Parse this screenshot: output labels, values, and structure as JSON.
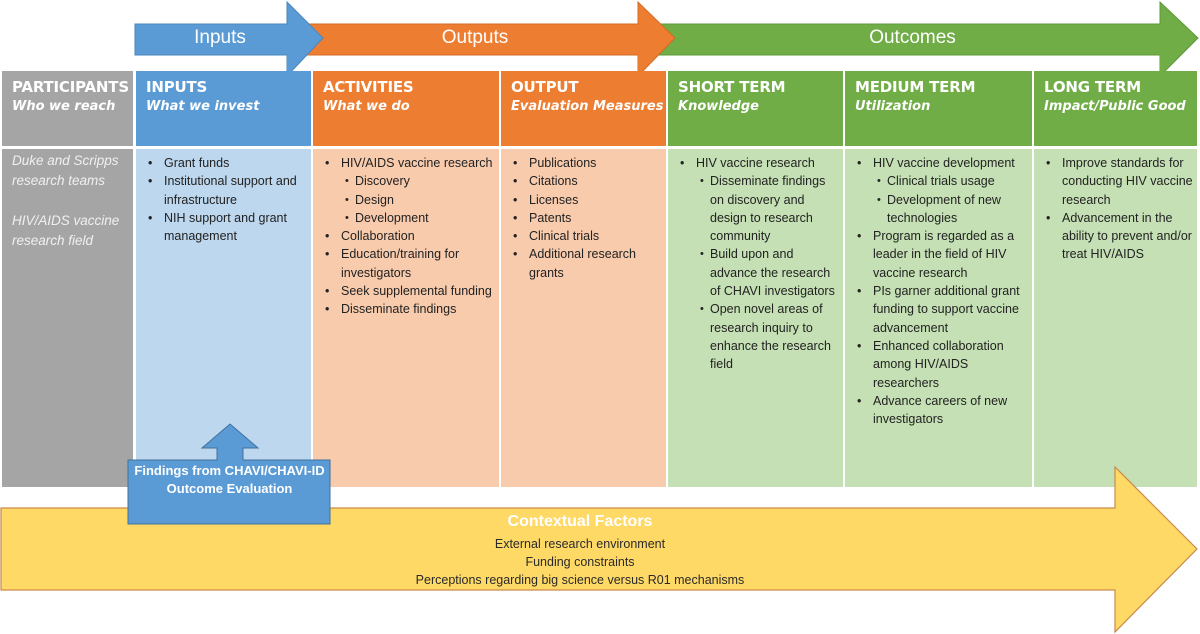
{
  "colors": {
    "participants": "#a5a5a5",
    "participants_body": "#a5a5a5",
    "inputs": "#5b9bd5",
    "inputs_body": "#bdd7ee",
    "outputs": "#ed7d31",
    "outputs_body": "#f8cbad",
    "outcomes": "#70ad47",
    "outcomes_body": "#c5e0b4",
    "context": "#ffd966",
    "context_border": "#c55a11"
  },
  "top_arrows": [
    {
      "label": "Inputs"
    },
    {
      "label": "Outputs"
    },
    {
      "label": "Outcomes"
    }
  ],
  "columns": [
    {
      "title": "PARTICIPANTS",
      "subtitle": "Who we reach",
      "paragraphs": [
        "Duke and Scripps research teams",
        "HIV/AIDS vaccine research field"
      ]
    },
    {
      "title": "INPUTS",
      "subtitle": "What we invest",
      "items": [
        {
          "text": "Grant funds"
        },
        {
          "text": "Institutional support and infrastructure"
        },
        {
          "text": "NIH support and grant management"
        }
      ]
    },
    {
      "title": "ACTIVITIES",
      "subtitle": "What we do",
      "items": [
        {
          "text": "HIV/AIDS vaccine research",
          "sub": [
            "Discovery",
            "Design",
            "Development"
          ]
        },
        {
          "text": "Collaboration"
        },
        {
          "text": "Education/training for investigators"
        },
        {
          "text": "Seek supplemental funding"
        },
        {
          "text": "Disseminate findings"
        }
      ]
    },
    {
      "title": "OUTPUT",
      "subtitle": "Evaluation Measures",
      "items": [
        {
          "text": "Publications"
        },
        {
          "text": "Citations"
        },
        {
          "text": "Licenses"
        },
        {
          "text": "Patents"
        },
        {
          "text": "Clinical trials"
        },
        {
          "text": "Additional research grants"
        }
      ]
    },
    {
      "title": "SHORT TERM",
      "subtitle": "Knowledge",
      "items": [
        {
          "text": "HIV vaccine research",
          "sub": [
            "Disseminate findings on discovery and design to research community",
            "Build upon and advance the research of CHAVI investigators",
            "Open novel areas of research inquiry to enhance the research field"
          ]
        }
      ]
    },
    {
      "title": "MEDIUM TERM",
      "subtitle": "Utilization",
      "items": [
        {
          "text": "HIV vaccine development",
          "sub": [
            "Clinical trials usage",
            "Development of new technologies"
          ]
        },
        {
          "text": "Program is regarded as a leader in the field of HIV vaccine research"
        },
        {
          "text": "PIs garner additional grant funding to support vaccine advancement"
        },
        {
          "text": "Enhanced collaboration among HIV/AIDS researchers"
        },
        {
          "text": "Advance careers of new investigators"
        }
      ]
    },
    {
      "title": "LONG TERM",
      "subtitle": "Impact/Public Good",
      "items": [
        {
          "text": "Improve standards for conducting HIV vaccine research"
        },
        {
          "text": "Advancement in the ability to prevent and/or treat HIV/AIDS"
        }
      ]
    }
  ],
  "callout": {
    "text": "Findings from CHAVI/CHAVI-ID Outcome Evaluation"
  },
  "context": {
    "title": "Contextual Factors",
    "lines": [
      "External research environment",
      "Funding constraints",
      "Perceptions regarding big science versus R01 mechanisms"
    ]
  }
}
